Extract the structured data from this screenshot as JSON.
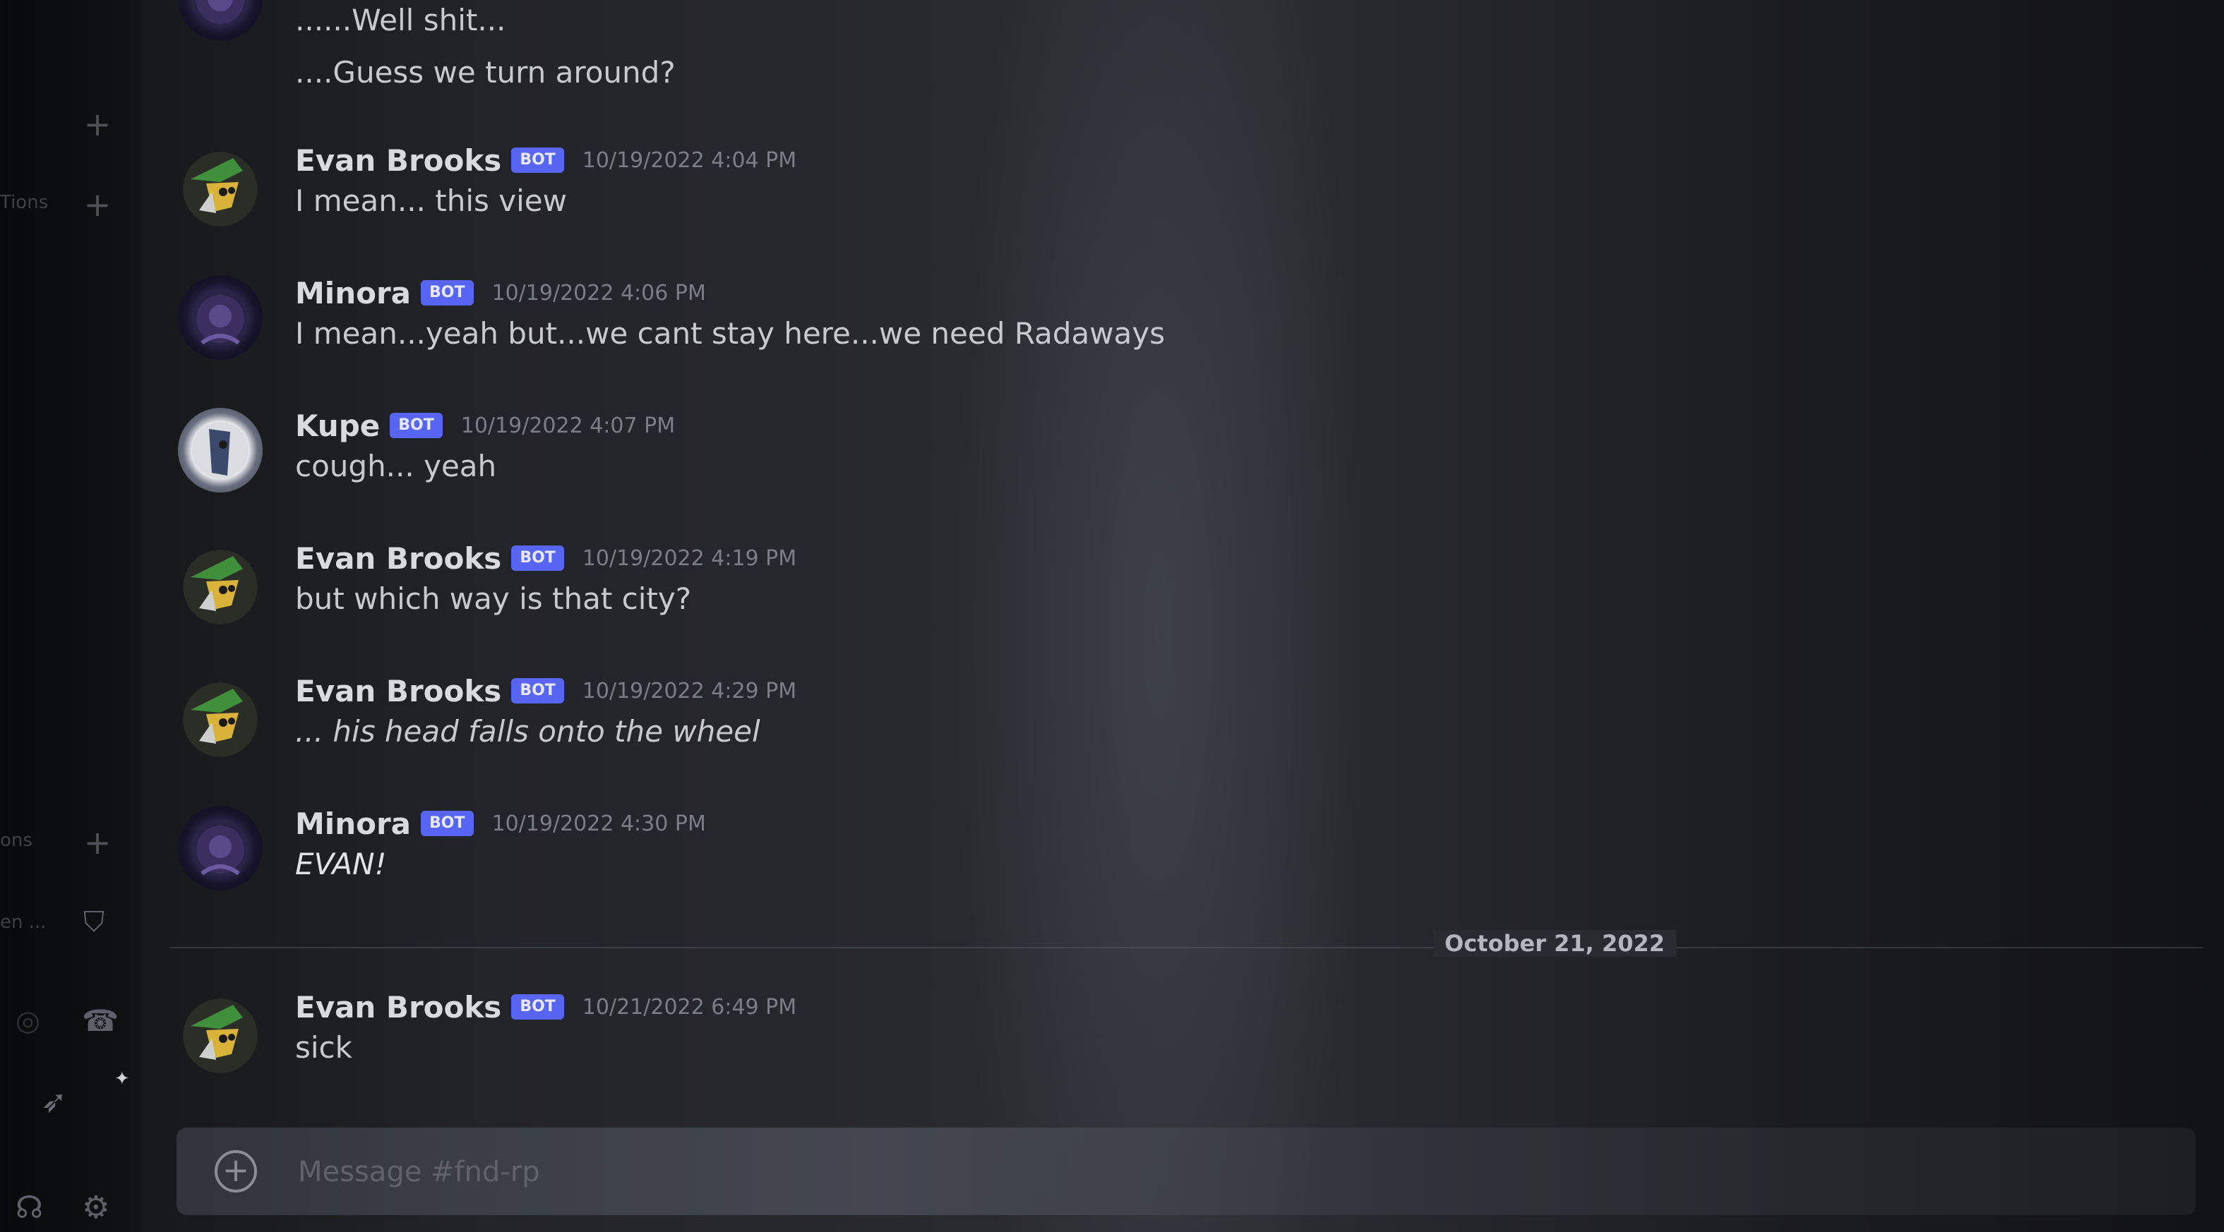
{
  "sidebar": {
    "labels": [
      "Tions",
      "ons",
      "en ..."
    ],
    "icons": [
      "add-channel-icon",
      "add-channel-icon",
      "add-channel-icon",
      "shield-icon",
      "phone-icon",
      "rocket-icon",
      "headset-icon",
      "settings-icon"
    ]
  },
  "messages": [
    {
      "author": "",
      "bot": "",
      "timestamp": "",
      "lines": [
        "......Well shit...",
        "....Guess we turn around?"
      ],
      "avatar": "minora-avatar"
    },
    {
      "author": "Evan Brooks",
      "bot": "BOT",
      "timestamp": "10/19/2022 4:04 PM",
      "lines": [
        "I mean... this view"
      ],
      "avatar": "goblin-avatar"
    },
    {
      "author": "Minora",
      "bot": "BOT",
      "timestamp": "10/19/2022 4:06 PM",
      "lines": [
        "I mean...yeah but...we cant stay here...we need Radaways"
      ],
      "avatar": "minora-avatar"
    },
    {
      "author": "Kupe",
      "bot": "BOT",
      "timestamp": "10/19/2022 4:07 PM",
      "lines": [
        "cough... yeah"
      ],
      "avatar": "kupe-avatar"
    },
    {
      "author": "Evan Brooks",
      "bot": "BOT",
      "timestamp": "10/19/2022 4:19 PM",
      "lines": [
        "but which way is that city?"
      ],
      "avatar": "goblin-avatar"
    },
    {
      "author": "Evan Brooks",
      "bot": "BOT",
      "timestamp": "10/19/2022 4:29 PM",
      "lines": [
        "... his head falls onto the wheel"
      ],
      "avatar": "goblin-avatar",
      "italic": true
    },
    {
      "author": "Minora",
      "bot": "BOT",
      "timestamp": "10/19/2022 4:30 PM",
      "lines": [
        "EVAN!"
      ],
      "avatar": "minora-avatar",
      "italic": true
    },
    {
      "author": "Evan Brooks",
      "bot": "BOT",
      "timestamp": "10/21/2022 6:49 PM",
      "lines": [
        "sick"
      ],
      "avatar": "goblin-avatar"
    }
  ],
  "divider": {
    "date": "October 21, 2022"
  },
  "composer": {
    "placeholder": "Message #fnd-rp",
    "add_icon": "plus-circle-icon"
  },
  "colors": {
    "bot_badge": "#5865f2",
    "background": "#2b2c31"
  }
}
